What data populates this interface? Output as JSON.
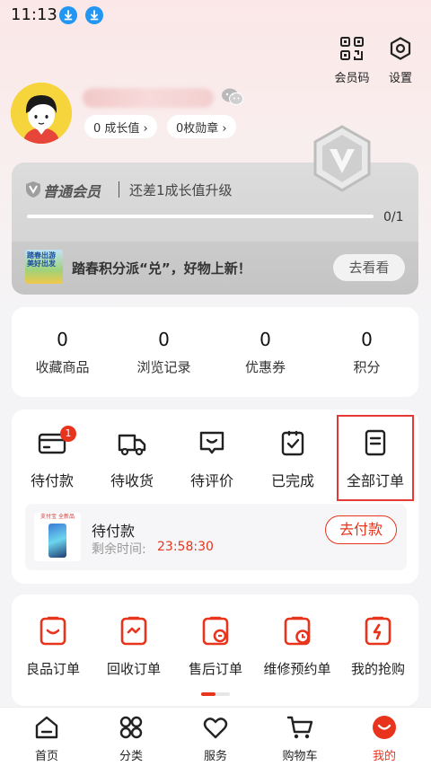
{
  "status_bar": {
    "time": "11:13"
  },
  "header": {
    "member_code_label": "会员码",
    "settings_label": "设置"
  },
  "profile": {
    "growth_label": "0 成长值 ›",
    "badges_label": "0枚勋章 ›"
  },
  "member_card": {
    "level": "普通会员",
    "upgrade_text": "还差1成长值升级",
    "progress_text": "0/1",
    "progress": 0,
    "promo_thumb_text": "踏春出游 美好出发",
    "promo_text": "踏春积分派“兑”，好物上新！",
    "promo_button": "去看看"
  },
  "stats": [
    {
      "value": "0",
      "label": "收藏商品"
    },
    {
      "value": "0",
      "label": "浏览记录"
    },
    {
      "value": "0",
      "label": "优惠券"
    },
    {
      "value": "0",
      "label": "积分"
    }
  ],
  "orders": {
    "items": [
      {
        "label": "待付款",
        "badge": "1"
      },
      {
        "label": "待收货"
      },
      {
        "label": "待评价"
      },
      {
        "label": "已完成"
      },
      {
        "label": "全部订单"
      }
    ],
    "pending": {
      "thumb_text": "支付宝 全新品",
      "title": "待付款",
      "countdown_label": "剩余时间:",
      "countdown_value": "23:58:30",
      "pay_button": "去付款"
    }
  },
  "services": [
    {
      "label": "良品订单"
    },
    {
      "label": "回收订单"
    },
    {
      "label": "售后订单"
    },
    {
      "label": "维修预约单"
    },
    {
      "label": "我的抢购"
    }
  ],
  "bottom_nav": [
    {
      "label": "首页"
    },
    {
      "label": "分类"
    },
    {
      "label": "服务"
    },
    {
      "label": "购物车"
    },
    {
      "label": "我的",
      "active": true
    }
  ],
  "colors": {
    "accent": "#e8341c",
    "highlight_box": "#e53935",
    "countdown": "#e8341c"
  }
}
